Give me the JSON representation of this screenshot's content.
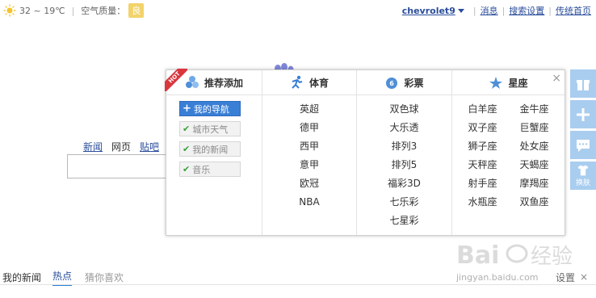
{
  "weather": {
    "temp": "32 ~ 19℃",
    "air_label": "空气质量：",
    "air_value": "良"
  },
  "topbar": {
    "user": "chevrolet9",
    "links": [
      "消息",
      "搜索设置",
      "传统首页"
    ]
  },
  "search_nav": {
    "items": [
      "新闻",
      "网页",
      "贴吧"
    ],
    "current": "网页"
  },
  "panel": {
    "recommend": {
      "title": "推荐添加",
      "hot_badge": "HOT",
      "items": [
        {
          "label": "我的导航",
          "active": true
        },
        {
          "label": "城市天气",
          "active": false
        },
        {
          "label": "我的新闻",
          "active": false
        },
        {
          "label": "音乐",
          "active": false
        }
      ]
    },
    "sports": {
      "title": "体育",
      "items": [
        "英超",
        "德甲",
        "西甲",
        "意甲",
        "欧冠",
        "NBA"
      ]
    },
    "lottery": {
      "title": "彩票",
      "items": [
        "双色球",
        "大乐透",
        "排列3",
        "排列5",
        "福彩3D",
        "七乐彩",
        "七星彩"
      ]
    },
    "zodiac": {
      "title": "星座",
      "items": [
        "白羊座",
        "金牛座",
        "双子座",
        "巨蟹座",
        "狮子座",
        "处女座",
        "天秤座",
        "天蝎座",
        "射手座",
        "摩羯座",
        "水瓶座",
        "双鱼座"
      ]
    },
    "close": "×"
  },
  "sidebar": {
    "skin_label": "换肤"
  },
  "news": {
    "title": "我的新闻",
    "tabs": [
      "热点",
      "猜你喜欢"
    ],
    "settings": "设置",
    "close": "×"
  },
  "watermark": {
    "text": "jingyan.baidu.com"
  },
  "colors": {
    "accent": "#3a7fd6",
    "sidebar": "#a9cdef",
    "hot": "#d9363e",
    "air_badge": "#f2d36b"
  }
}
